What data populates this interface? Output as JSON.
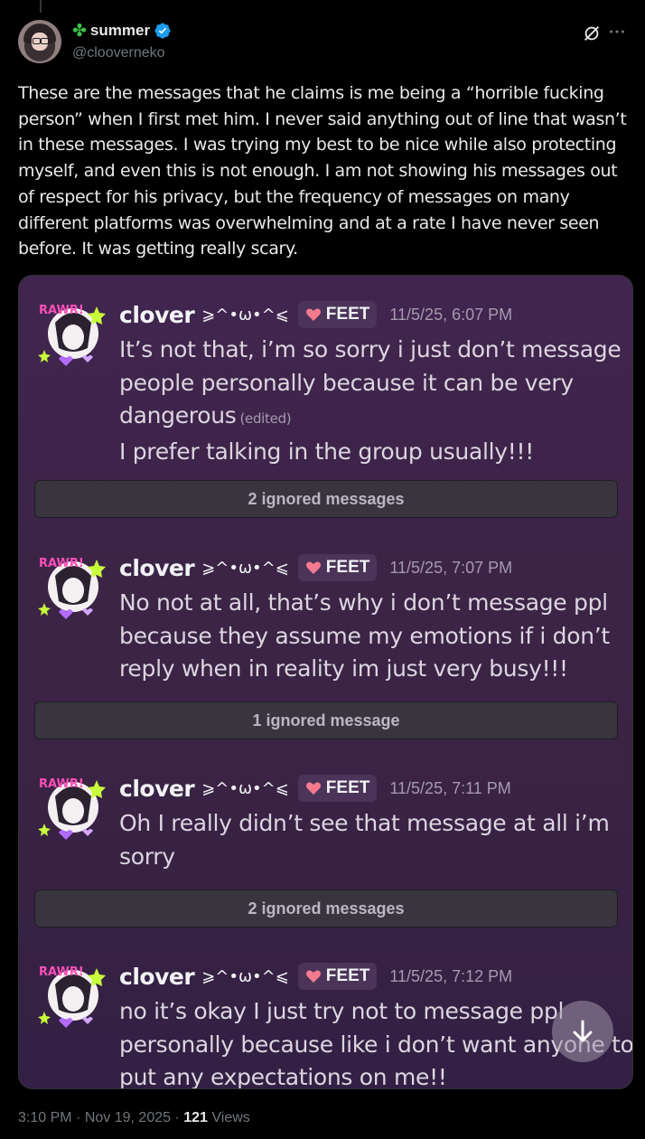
{
  "tweet": {
    "display_name": "summer",
    "name_emoji": "✤",
    "handle": "@clooverneko",
    "text": "These are the messages that he claims is me being a “horrible fucking person” when I first met him. I never said anything out of line that wasn’t in these messages. I was trying my best to be nice while also protecting myself, and even this is not enough. I am not showing his messages out of respect for his privacy, but the frequency of messages on many different platforms was overwhelming and at a rate I have never seen before. It was getting really scary.",
    "time": "3:10 PM",
    "date": "Nov 19, 2025",
    "views_count": "121",
    "views_label": "Views",
    "separator": "·"
  },
  "icons": {
    "verified": "verified-badge-icon",
    "grok": "grok-icon",
    "more": "more-options-icon",
    "scroll": "arrow-down-icon"
  },
  "screenshot": {
    "messages": [
      {
        "author": "clover",
        "kaomoji": "⩾^•ω•^⩽",
        "tag": "FEET",
        "timestamp": "11/5/25, 6:07 PM",
        "lines": [
          "It’s not that,  i’m so sorry i just don’t message",
          "people personally because it can be very",
          "dangerous",
          "I prefer talking in the group usually!!!"
        ],
        "edited": "(edited)"
      },
      {
        "author": "clover",
        "kaomoji": "⩾^•ω•^⩽",
        "tag": "FEET",
        "timestamp": "11/5/25, 7:07 PM",
        "lines": [
          "No not at all, that’s why i don’t message ppl",
          "because they assume my emotions if i don’t",
          "reply when in reality im just very busy!!!"
        ]
      },
      {
        "author": "clover",
        "kaomoji": "⩾^•ω•^⩽",
        "tag": "FEET",
        "timestamp": "11/5/25, 7:11 PM",
        "lines": [
          "Oh I really didn’t see that message at all i’m",
          "sorry"
        ]
      },
      {
        "author": "clover",
        "kaomoji": "⩾^•ω•^⩽",
        "tag": "FEET",
        "timestamp": "11/5/25, 7:12 PM",
        "lines": [
          "no it’s okay I just try not to message ppl",
          "personally because like i don’t want anyone to",
          "put any expectations on me!!"
        ]
      }
    ],
    "ignored": [
      "2 ignored messages",
      "1 ignored message",
      "2 ignored messages"
    ],
    "avatar_text": "RAWR!",
    "accent_colors": {
      "tag_bg": "#4b3359",
      "background": "#3c2447",
      "heart": "#f47a8e"
    }
  }
}
